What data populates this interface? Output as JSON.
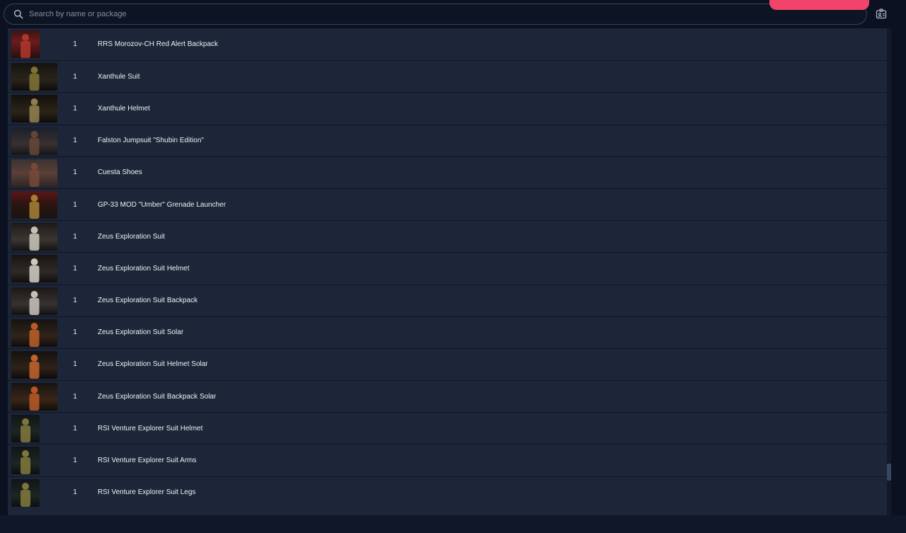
{
  "search": {
    "placeholder": "Search by name or package"
  },
  "colors": {
    "accent": "#f0446a",
    "row_bg": "#1c2638",
    "page_bg": "#0b1120"
  },
  "icons": {
    "search": "search-icon",
    "profile": "id-card-icon"
  },
  "items": [
    {
      "qty": "1",
      "name": "RRS Morozov-CH Red Alert Backpack"
    },
    {
      "qty": "1",
      "name": "Xanthule Suit"
    },
    {
      "qty": "1",
      "name": "Xanthule Helmet"
    },
    {
      "qty": "1",
      "name": "Falston Jumpsuit \"Shubin Edition\""
    },
    {
      "qty": "1",
      "name": "Cuesta Shoes"
    },
    {
      "qty": "1",
      "name": "GP-33 MOD \"Umber\" Grenade Launcher"
    },
    {
      "qty": "1",
      "name": "Zeus Exploration Suit"
    },
    {
      "qty": "1",
      "name": "Zeus Exploration Suit Helmet"
    },
    {
      "qty": "1",
      "name": "Zeus Exploration Suit Backpack"
    },
    {
      "qty": "1",
      "name": "Zeus Exploration Suit Solar"
    },
    {
      "qty": "1",
      "name": "Zeus Exploration Suit Helmet Solar"
    },
    {
      "qty": "1",
      "name": "Zeus Exploration Suit Backpack Solar"
    },
    {
      "qty": "1",
      "name": "RSI Venture Explorer Suit Helmet"
    },
    {
      "qty": "1",
      "name": "RSI Venture Explorer Suit Arms"
    },
    {
      "qty": "1",
      "name": "RSI Venture Explorer Suit Legs"
    }
  ]
}
